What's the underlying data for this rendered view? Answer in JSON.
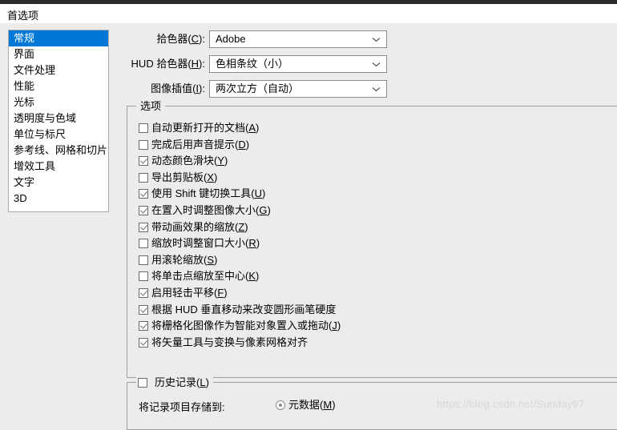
{
  "window": {
    "title": "首选项"
  },
  "sidebar": {
    "items": [
      {
        "label": "常规",
        "selected": true
      },
      {
        "label": "界面",
        "selected": false
      },
      {
        "label": "文件处理",
        "selected": false
      },
      {
        "label": "性能",
        "selected": false
      },
      {
        "label": "光标",
        "selected": false
      },
      {
        "label": "透明度与色域",
        "selected": false
      },
      {
        "label": "单位与标尺",
        "selected": false
      },
      {
        "label": "参考线、网格和切片",
        "selected": false
      },
      {
        "label": "增效工具",
        "selected": false
      },
      {
        "label": "文字",
        "selected": false
      },
      {
        "label": "3D",
        "selected": false
      }
    ]
  },
  "form": {
    "rows": [
      {
        "label_pre": "拾色器(",
        "label_acc": "C",
        "label_post": "):",
        "value": "Adobe"
      },
      {
        "label_pre": "HUD 拾色器(",
        "label_acc": "H",
        "label_post": "):",
        "value": "色相条纹（小）"
      },
      {
        "label_pre": "图像插值(",
        "label_acc": "I",
        "label_post": "):",
        "value": "两次立方（自动）"
      }
    ]
  },
  "options_group": {
    "legend": "选项",
    "checkboxes": [
      {
        "label_pre": "自动更新打开的文档(",
        "label_acc": "A",
        "label_post": ")",
        "checked": false
      },
      {
        "label_pre": "完成后用声音提示(",
        "label_acc": "D",
        "label_post": ")",
        "checked": false
      },
      {
        "label_pre": "动态颜色滑块(",
        "label_acc": "Y",
        "label_post": ")",
        "checked": true
      },
      {
        "label_pre": "导出剪贴板(",
        "label_acc": "X",
        "label_post": ")",
        "checked": false
      },
      {
        "label_pre": "使用 Shift 键切换工具(",
        "label_acc": "U",
        "label_post": ")",
        "checked": true
      },
      {
        "label_pre": "在置入时调整图像大小(",
        "label_acc": "G",
        "label_post": ")",
        "checked": true
      },
      {
        "label_pre": "带动画效果的缩放(",
        "label_acc": "Z",
        "label_post": ")",
        "checked": true
      },
      {
        "label_pre": "缩放时调整窗口大小(",
        "label_acc": "R",
        "label_post": ")",
        "checked": false
      },
      {
        "label_pre": "用滚轮缩放(",
        "label_acc": "S",
        "label_post": ")",
        "checked": false
      },
      {
        "label_pre": "将单击点缩放至中心(",
        "label_acc": "K",
        "label_post": ")",
        "checked": false
      },
      {
        "label_pre": "启用轻击平移(",
        "label_acc": "F",
        "label_post": ")",
        "checked": true
      },
      {
        "label_pre": "根据 HUD 垂直移动来改变圆形画笔硬度",
        "label_acc": "",
        "label_post": "",
        "checked": true
      },
      {
        "label_pre": "将栅格化图像作为智能对象置入或拖动(",
        "label_acc": "J",
        "label_post": ")",
        "checked": true
      },
      {
        "label_pre": "将矢量工具与变换与像素网格对齐",
        "label_acc": "",
        "label_post": "",
        "checked": true
      }
    ]
  },
  "history_group": {
    "legend_pre": "历史记录(",
    "legend_acc": "L",
    "legend_post": ")",
    "checked": false,
    "store_label": "将记录项目存储到:",
    "radio_pre": "元数据(",
    "radio_acc": "M",
    "radio_post": ")",
    "radio_selected": true
  },
  "watermark": {
    "text": "https://blog.csdn.net/Sunday97"
  },
  "colors": {
    "selection_blue": "#0078D7",
    "dialog_bg": "#ECECEC",
    "title_bg": "#FFFFFF",
    "border": "#A0A0A0"
  }
}
